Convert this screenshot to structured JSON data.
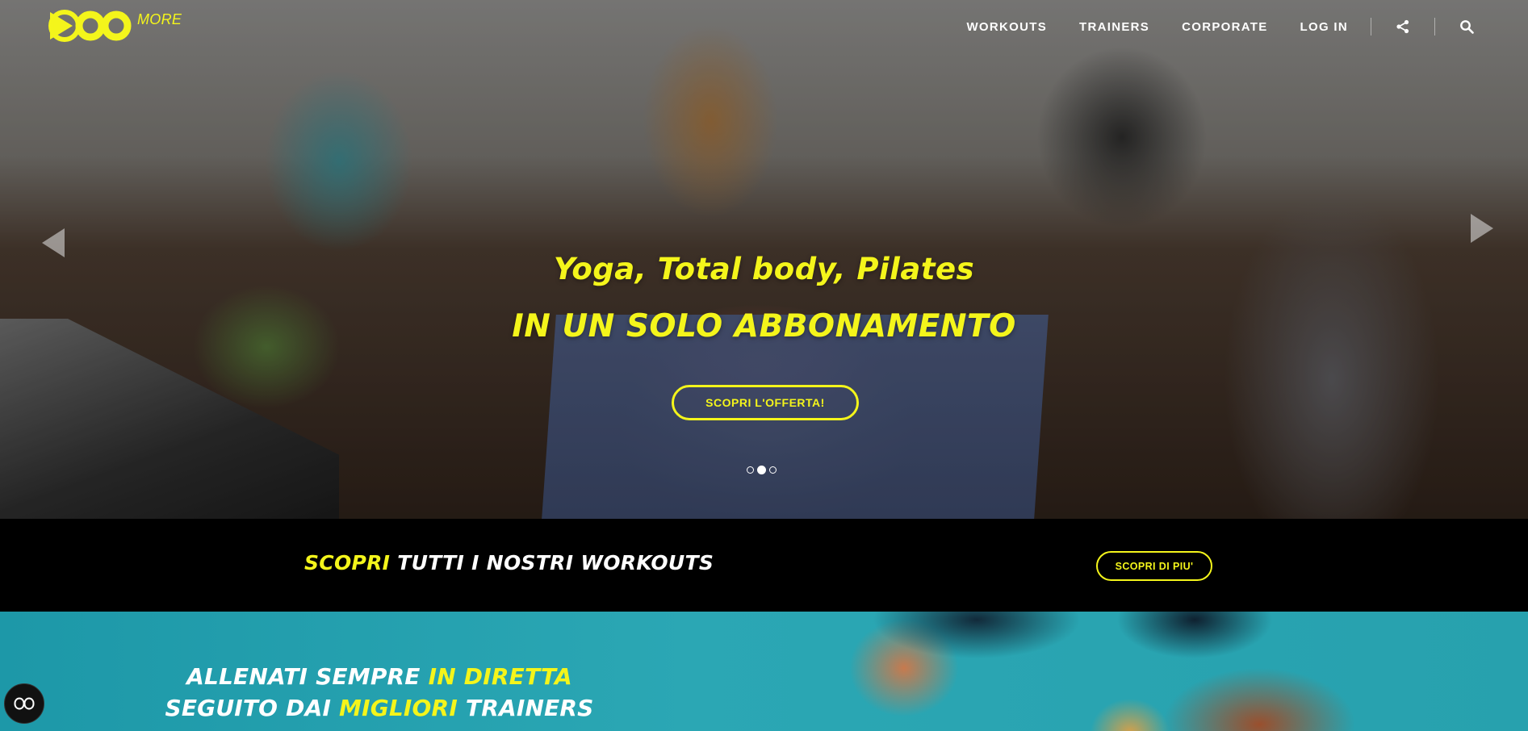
{
  "brand": {
    "name": "DOO",
    "suffix": "MORE",
    "accent_color": "#f4f51b"
  },
  "nav": {
    "items": [
      "WORKOUTS",
      "TRAINERS",
      "CORPORATE",
      "LOG IN"
    ],
    "icons": [
      "share-icon",
      "search-icon"
    ]
  },
  "hero": {
    "line1": "Yoga, Total body, Pilates",
    "line2": "IN UN SOLO ABBONAMENTO",
    "cta": "SCOPRI L'OFFERTA!",
    "slides": {
      "count": 3,
      "active": 2
    }
  },
  "band": {
    "title_highlight": "SCOPRI",
    "title_rest": "TUTTI I NOSTRI WORKOUTS",
    "button": "SCOPRI DI PIU'"
  },
  "teal": {
    "line1_a": "ALLENATI SEMPRE",
    "line1_b": "IN DIRETTA",
    "line2_a": "SEGUITO DAI",
    "line2_b": "MIGLIORI",
    "line2_c": "TRAINERS"
  },
  "colors": {
    "yellow": "#f4f51b",
    "teal": "#2ba7b4",
    "black": "#000000"
  }
}
